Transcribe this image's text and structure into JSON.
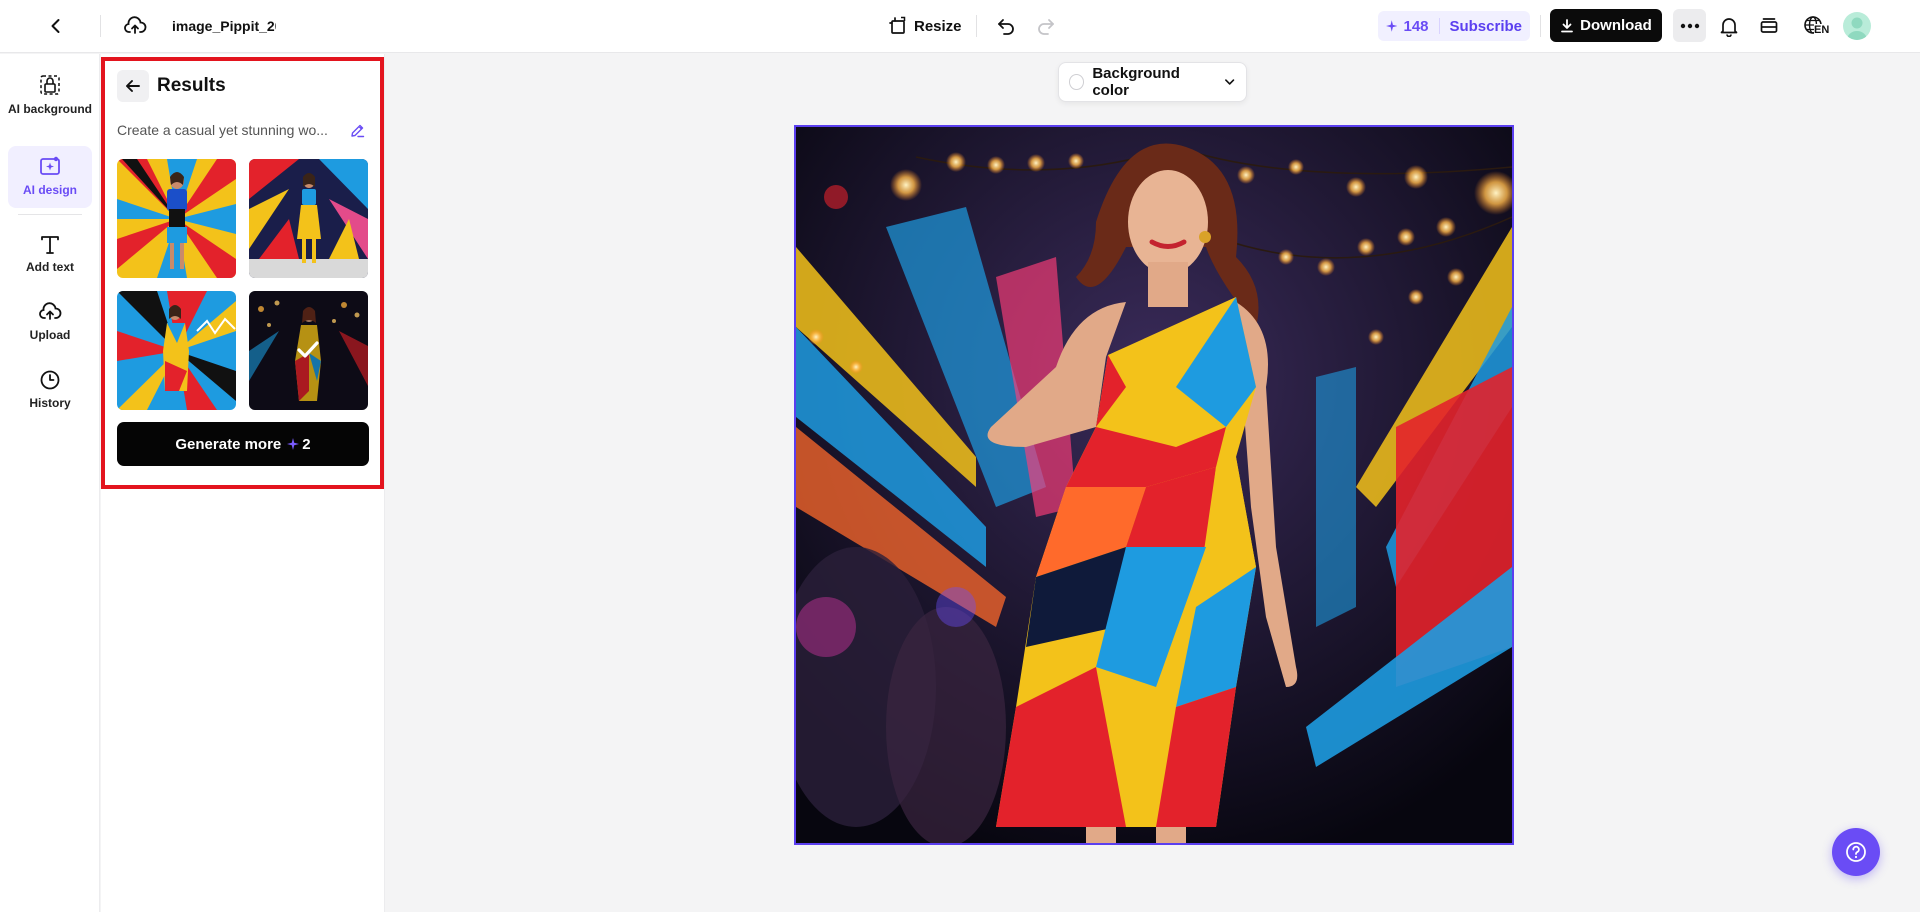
{
  "header": {
    "filename": "image_Pippit_20",
    "resize_label": "Resize",
    "credits_count": "148",
    "subscribe_label": "Subscribe",
    "download_label": "Download",
    "language_code": "EN"
  },
  "rail": {
    "items": [
      {
        "label": "AI background",
        "icon": "ai-background-icon"
      },
      {
        "label": "AI design",
        "icon": "ai-design-icon"
      },
      {
        "label": "Add text",
        "icon": "text-icon"
      },
      {
        "label": "Upload",
        "icon": "upload-icon"
      },
      {
        "label": "History",
        "icon": "clock-icon"
      }
    ]
  },
  "panel": {
    "title": "Results",
    "prompt": "Create a casual yet stunning wo...",
    "generate_label": "Generate more",
    "generate_cost": "2"
  },
  "canvas": {
    "bg_color_label": "Background color"
  },
  "colors": {
    "accent": "#6a4cf5",
    "highlight": "#e3141e",
    "dark": "#0b0b0b"
  }
}
